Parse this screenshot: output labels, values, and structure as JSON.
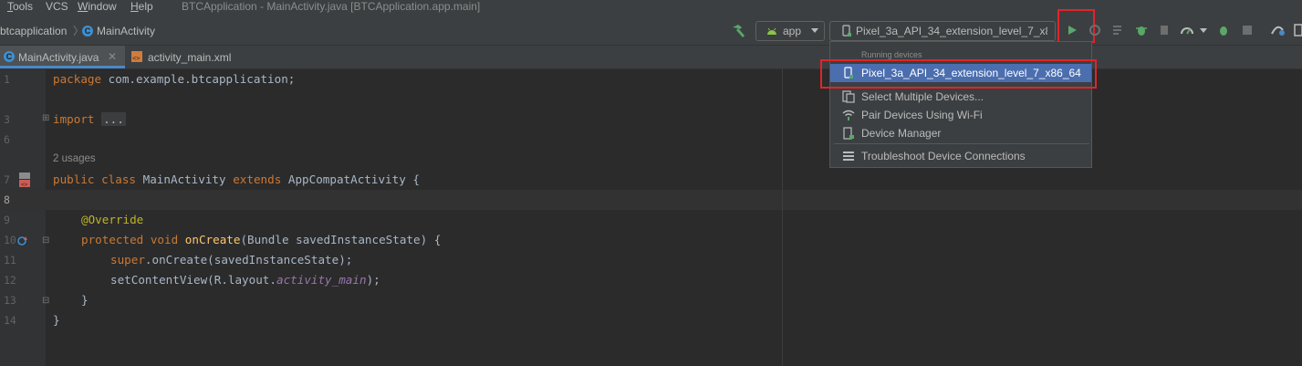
{
  "menubar": {
    "items": [
      {
        "label": "Tools",
        "mnemonic": "T",
        "rest": "ools"
      },
      {
        "label": "VCS",
        "mnemonic": "",
        "rest": "VCS"
      },
      {
        "label": "Window",
        "mnemonic": "W",
        "rest": "indow"
      },
      {
        "label": "Help",
        "mnemonic": "H",
        "rest": "elp"
      }
    ],
    "window_title": "BTCApplication - MainActivity.java [BTCApplication.app.main]"
  },
  "navbar": {
    "breadcrumb_project": "btcapplication",
    "breadcrumb_class": "MainActivity",
    "run_config": "app",
    "device_selector": "Pixel_3a_API_34_extension_level_7_x86..."
  },
  "tabs": [
    {
      "label": "MainActivity.java",
      "active": true
    },
    {
      "label": "activity_main.xml",
      "active": false
    }
  ],
  "editor": {
    "line_numbers": [
      "1",
      "3",
      "6",
      "7",
      "8",
      "9",
      "10",
      "11",
      "12",
      "13",
      "14"
    ],
    "usages_hint": "2 usages",
    "lines": {
      "l1_kw": "package",
      "l1_rest": " com.example.btcapplication;",
      "l3_kw": "import",
      "l3_fold": "...",
      "l7_kw1": "public",
      "l7_kw2": "class",
      "l7_name": "MainActivity",
      "l7_kw3": "extends",
      "l7_super": "AppCompatActivity {",
      "l9_ann": "@Override",
      "l10_kw1": "protected",
      "l10_kw2": "void",
      "l10_method": "onCreate",
      "l10_rest": "(Bundle savedInstanceState) {",
      "l11_kw": "super",
      "l11_rest": ".onCreate(savedInstanceState);",
      "l12_a": "setContentView(R.layout.",
      "l12_field": "activity_main",
      "l12_b": ");",
      "l13": "}",
      "l14": "}"
    }
  },
  "device_popup": {
    "header": "Running devices",
    "items": [
      {
        "label": "Pixel_3a_API_34_extension_level_7_x86_64",
        "icon": "phone-running-icon",
        "selected": true
      },
      {
        "label": "Select Multiple Devices...",
        "icon": "multi-device-icon",
        "selected": false
      },
      {
        "label": "Pair Devices Using Wi-Fi",
        "icon": "wifi-icon",
        "selected": false
      },
      {
        "label": "Device Manager",
        "icon": "device-manager-icon",
        "selected": false
      },
      {
        "label": "Troubleshoot Device Connections",
        "icon": "list-icon",
        "selected": false
      }
    ]
  },
  "colors": {
    "accent_run": "#59a869",
    "highlight_box": "#e0242a",
    "selection": "#4b6eaf"
  }
}
